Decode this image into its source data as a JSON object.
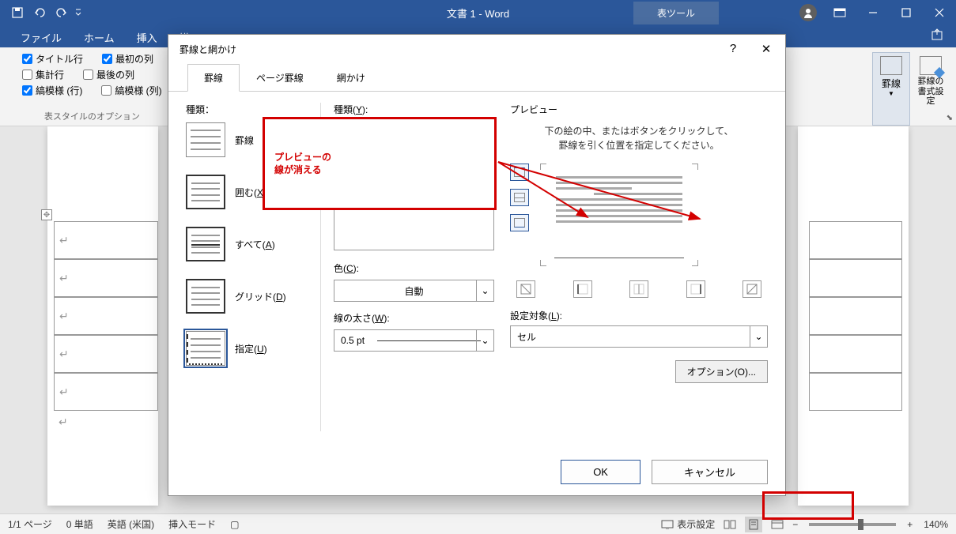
{
  "titlebar": {
    "doc_title": "文書 1 - Word",
    "tool_tab": "表ツール"
  },
  "ribbon_tabs": [
    "ファイル",
    "ホーム",
    "挿入",
    "描"
  ],
  "ribbon": {
    "style_options": {
      "title_row": "タイトル行",
      "first_col": "最初の列",
      "total_row": "集計行",
      "last_col": "最後の列",
      "banded_rows": "縞模様 (行)",
      "banded_cols": "縞模様 (列)",
      "group_label": "表スタイルのオプション"
    },
    "borders_btn": "罫線",
    "border_style_btn": "罫線の\n書式設定"
  },
  "dialog": {
    "title": "罫線と網かけ",
    "tabs": {
      "borders": "罫線",
      "page_border": "ページ罫線",
      "shading": "網かけ"
    },
    "kinds_label": "種類：",
    "kinds": {
      "none": "罫線",
      "box": "囲む(",
      "all": "すべて(",
      "grid": "グリッド(",
      "custom": "指定("
    },
    "kind_keys": {
      "box": "X",
      "all": "A",
      "grid": "D",
      "custom": "U"
    },
    "style_label": "種類(",
    "style_key": "Y",
    "color_label": "色(",
    "color_key": "C",
    "color_value": "自動",
    "width_label": "線の太さ(",
    "width_key": "W",
    "width_value": "0.5 pt",
    "preview_label": "プレビュー",
    "preview_hint1": "下の絵の中、またはボタンをクリックして、",
    "preview_hint2": "罫線を引く位置を指定してください。",
    "target_label": "設定対象(",
    "target_key": "L",
    "target_value": "セル",
    "options_btn": "オプション(O)...",
    "ok": "OK",
    "cancel": "キャンセル"
  },
  "callout": {
    "line1": "プレビューの",
    "line2": "線が消える"
  },
  "statusbar": {
    "page": "1/1 ページ",
    "words": "0 単語",
    "lang": "英語 (米国)",
    "insert": "挿入モード",
    "display": "表示設定",
    "zoom": "140%"
  }
}
